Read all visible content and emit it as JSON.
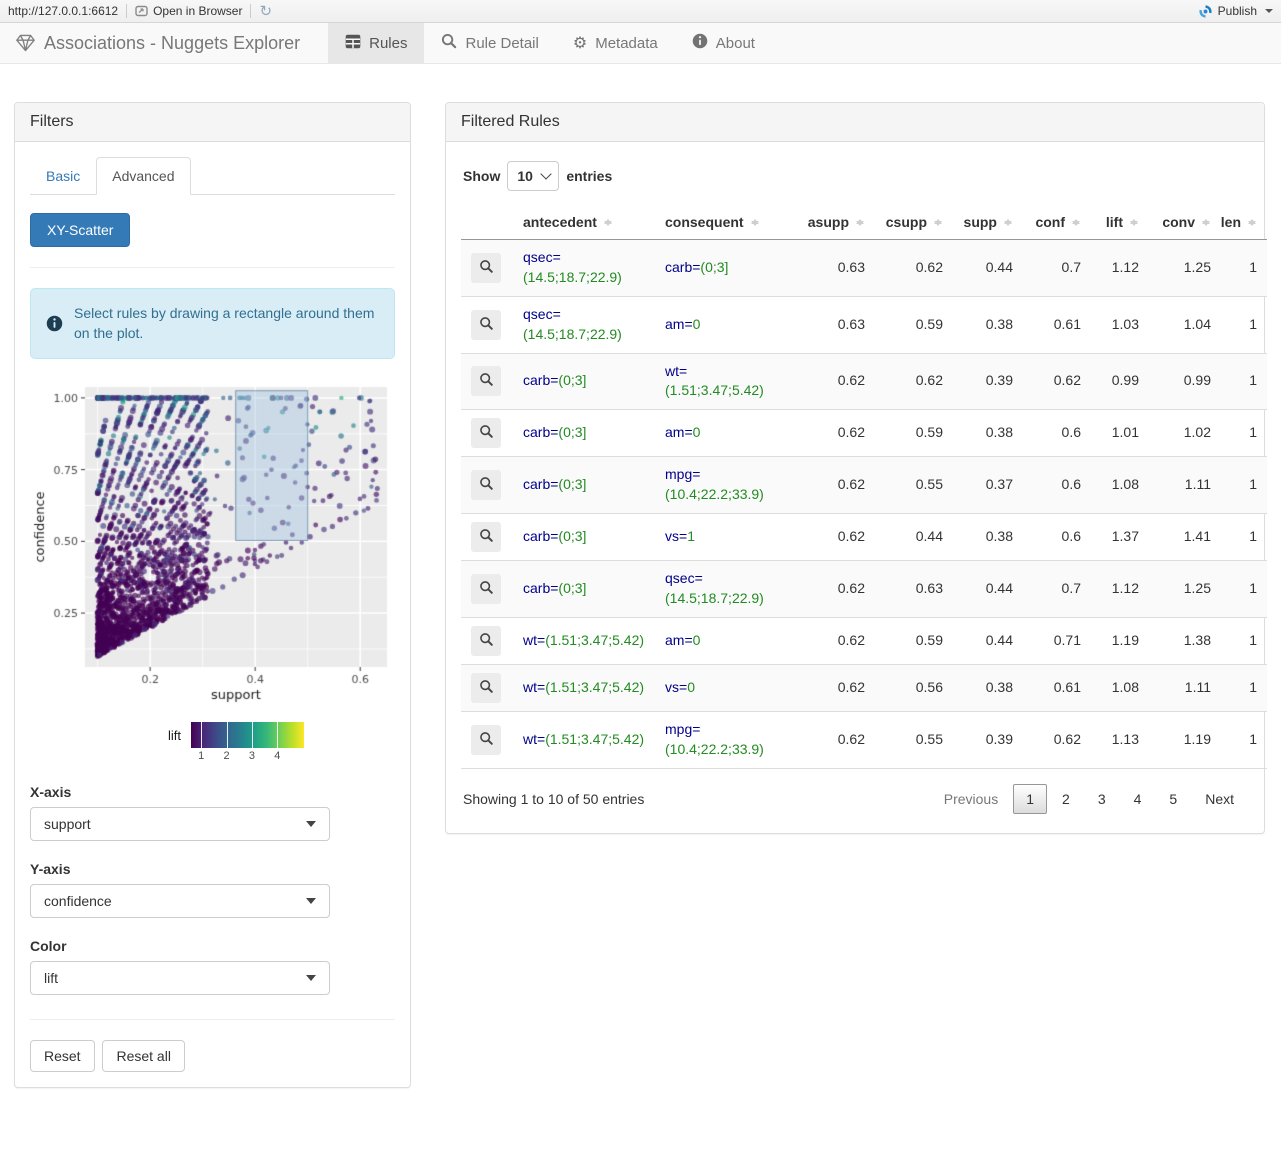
{
  "toolbar": {
    "url": "http://127.0.0.1:6612",
    "open_label": "Open in Browser",
    "publish_label": "Publish"
  },
  "navbar": {
    "title": "Associations - Nuggets Explorer",
    "tabs": [
      {
        "id": "rules",
        "label": "Rules",
        "icon": "table-icon",
        "active": true
      },
      {
        "id": "rule-detail",
        "label": "Rule Detail",
        "icon": "search-icon",
        "active": false
      },
      {
        "id": "metadata",
        "label": "Metadata",
        "icon": "gear-icon",
        "active": false
      },
      {
        "id": "about",
        "label": "About",
        "icon": "info-icon",
        "active": false
      }
    ]
  },
  "filters": {
    "title": "Filters",
    "tabs": [
      {
        "label": "Basic",
        "active": false
      },
      {
        "label": "Advanced",
        "active": true
      }
    ],
    "scatter_button": "XY-Scatter",
    "alert": "Select rules by drawing a rectangle around them on the plot.",
    "selects": [
      {
        "label": "X-axis",
        "value": "support"
      },
      {
        "label": "Y-axis",
        "value": "confidence"
      },
      {
        "label": "Color",
        "value": "lift"
      }
    ],
    "reset_label": "Reset",
    "reset_all_label": "Reset all"
  },
  "rules_panel": {
    "title": "Filtered Rules",
    "show_label": "Show",
    "entries_label": "entries",
    "page_length": "10",
    "columns": [
      "antecedent",
      "consequent",
      "asupp",
      "csupp",
      "supp",
      "conf",
      "lift",
      "conv",
      "len"
    ],
    "rows": [
      {
        "antecedent": {
          "attr": "qsec",
          "value": "(14.5;18.7;22.9)"
        },
        "consequent": {
          "attr": "carb",
          "value": "(0;3]"
        },
        "asupp": "0.63",
        "csupp": "0.62",
        "supp": "0.44",
        "conf": "0.7",
        "lift": "1.12",
        "conv": "1.25",
        "len": "1"
      },
      {
        "antecedent": {
          "attr": "qsec",
          "value": "(14.5;18.7;22.9)"
        },
        "consequent": {
          "attr": "am",
          "value": "0"
        },
        "asupp": "0.63",
        "csupp": "0.59",
        "supp": "0.38",
        "conf": "0.61",
        "lift": "1.03",
        "conv": "1.04",
        "len": "1"
      },
      {
        "antecedent": {
          "attr": "carb",
          "value": "(0;3]"
        },
        "consequent": {
          "attr": "wt",
          "value": "(1.51;3.47;5.42)"
        },
        "asupp": "0.62",
        "csupp": "0.62",
        "supp": "0.39",
        "conf": "0.62",
        "lift": "0.99",
        "conv": "0.99",
        "len": "1"
      },
      {
        "antecedent": {
          "attr": "carb",
          "value": "(0;3]"
        },
        "consequent": {
          "attr": "am",
          "value": "0"
        },
        "asupp": "0.62",
        "csupp": "0.59",
        "supp": "0.38",
        "conf": "0.6",
        "lift": "1.01",
        "conv": "1.02",
        "len": "1"
      },
      {
        "antecedent": {
          "attr": "carb",
          "value": "(0;3]"
        },
        "consequent": {
          "attr": "mpg",
          "value": "(10.4;22.2;33.9)"
        },
        "asupp": "0.62",
        "csupp": "0.55",
        "supp": "0.37",
        "conf": "0.6",
        "lift": "1.08",
        "conv": "1.11",
        "len": "1"
      },
      {
        "antecedent": {
          "attr": "carb",
          "value": "(0;3]"
        },
        "consequent": {
          "attr": "vs",
          "value": "1"
        },
        "asupp": "0.62",
        "csupp": "0.44",
        "supp": "0.38",
        "conf": "0.6",
        "lift": "1.37",
        "conv": "1.41",
        "len": "1"
      },
      {
        "antecedent": {
          "attr": "carb",
          "value": "(0;3]"
        },
        "consequent": {
          "attr": "qsec",
          "value": "(14.5;18.7;22.9)"
        },
        "asupp": "0.62",
        "csupp": "0.63",
        "supp": "0.44",
        "conf": "0.7",
        "lift": "1.12",
        "conv": "1.25",
        "len": "1"
      },
      {
        "antecedent": {
          "attr": "wt",
          "value": "(1.51;3.47;5.42)"
        },
        "consequent": {
          "attr": "am",
          "value": "0"
        },
        "asupp": "0.62",
        "csupp": "0.59",
        "supp": "0.44",
        "conf": "0.71",
        "lift": "1.19",
        "conv": "1.38",
        "len": "1"
      },
      {
        "antecedent": {
          "attr": "wt",
          "value": "(1.51;3.47;5.42)"
        },
        "consequent": {
          "attr": "vs",
          "value": "0"
        },
        "asupp": "0.62",
        "csupp": "0.56",
        "supp": "0.38",
        "conf": "0.61",
        "lift": "1.08",
        "conv": "1.11",
        "len": "1"
      },
      {
        "antecedent": {
          "attr": "wt",
          "value": "(1.51;3.47;5.42)"
        },
        "consequent": {
          "attr": "mpg",
          "value": "(10.4;22.2;33.9)"
        },
        "asupp": "0.62",
        "csupp": "0.55",
        "supp": "0.39",
        "conf": "0.62",
        "lift": "1.13",
        "conv": "1.19",
        "len": "1"
      }
    ],
    "summary": "Showing 1 to 10 of 50 entries",
    "pagination": {
      "previous": "Previous",
      "pages": [
        "1",
        "2",
        "3",
        "4",
        "5"
      ],
      "current": "1",
      "next": "Next"
    }
  },
  "colors": {
    "primary": "#337ab7",
    "attr_name": "#00008b",
    "attr_value": "#228b22",
    "alert_bg": "#d9edf7",
    "alert_text": "#31708f"
  },
  "chart_data": {
    "type": "scatter",
    "xlabel": "support",
    "ylabel": "confidence",
    "color_label": "lift",
    "x_domain": [
      0.076,
      0.651
    ],
    "y_domain": [
      0.062,
      1.038
    ],
    "x_ticks": [
      0.2,
      0.4,
      0.6
    ],
    "y_ticks": [
      0.25,
      0.5,
      0.75,
      1.0
    ],
    "y_tick_labels": [
      "0.25",
      "0.50",
      "0.75",
      "1.00"
    ],
    "x_minor": [
      0.1,
      0.3,
      0.5
    ],
    "y_minor": [
      0.125,
      0.375,
      0.625,
      0.875
    ],
    "selection_rect": {
      "x0": 0.363,
      "x1": 0.5,
      "y0": 0.503,
      "y1": 1.025
    },
    "legend": {
      "title": "lift",
      "domain": [
        0.6,
        5.05
      ],
      "ticks": [
        1,
        2,
        3,
        4
      ]
    },
    "palette": "viridis",
    "viridis_stops": [
      "#440154",
      "#482878",
      "#3e4a89",
      "#31688e",
      "#26828e",
      "#1f9e89",
      "#35b779",
      "#6ece58",
      "#b5de2b",
      "#fde725"
    ],
    "note": "Approx. 2200 association rules: support 0.1-0.63 (dense cluster at 0.1-0.3), confidence 0.1-1.0 with conf >= supp rays through the origin, colored by lift (mostly 0.8-2.5, few up to ~4); blue brush rectangle selects supp 0.36-0.50, conf 0.50-1.0",
    "generator": {
      "seed": 77,
      "n": 2200,
      "supp_min": 0.1,
      "cluster_frac": 0.86,
      "cluster_span": 0.21,
      "cluster_pow": 1.7,
      "tail_span": 0.535,
      "tail_pow": 1.6,
      "asupp_pow": 1.35,
      "asupp_step": 0.025,
      "conf_one_prob": 0.07,
      "csupp_min": 0.3,
      "csupp_max": 0.95,
      "extra_diag": 26,
      "radius_min": 2.1,
      "radius_max": 3.0,
      "alpha": 0.65
    }
  }
}
